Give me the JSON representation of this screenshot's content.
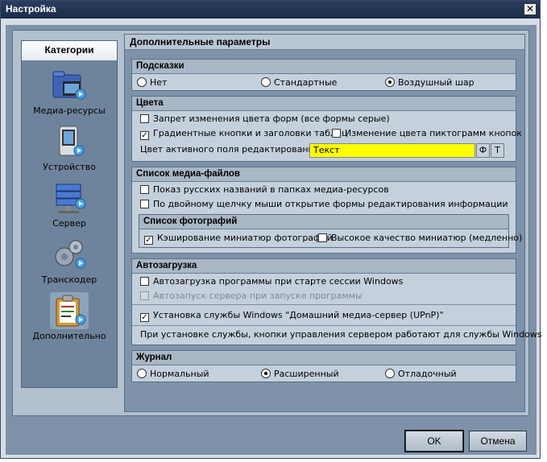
{
  "window": {
    "title": "Настройка"
  },
  "categories": {
    "header": "Категории",
    "items": [
      {
        "label": "Медиа-ресурсы"
      },
      {
        "label": "Устройство"
      },
      {
        "label": "Сервер"
      },
      {
        "label": "Транскодер"
      },
      {
        "label": "Дополнительно",
        "selected": true
      }
    ]
  },
  "main": {
    "title": "Дополнительные параметры",
    "hints": {
      "title": "Подсказки",
      "options": [
        "Нет",
        "Стандартные",
        "Воздушный шар"
      ],
      "selected": "Воздушный шар"
    },
    "colors": {
      "title": "Цвета",
      "forbid_change": "Запрет изменения цвета форм (все формы серые)",
      "gradient_buttons": "Градиентные кнопки и заголовки таблиц",
      "icon_color_change": "Изменение цвета пиктограмм кнопок",
      "active_field_label": "Цвет активного поля редактирования",
      "active_field_value": "Текст",
      "active_field_color": "#ffff00",
      "btn_f": "Ф",
      "btn_t": "Т"
    },
    "media_list": {
      "title": "Список медиа-файлов",
      "russian_names": "Показ русских названий в папках медиа-ресурсов",
      "double_click": "По двойному щелчку мыши открытие формы редактирования информации",
      "photos": {
        "title": "Список фотографий",
        "thumb_cache": "Кэширование миниатюр фотографий",
        "high_quality": "Высокое качество миниатюр (медленно)"
      }
    },
    "autoload": {
      "title": "Автозагрузка",
      "program_start": "Автозагрузка программы при старте сессии Windows",
      "server_start": "Автозапуск сервера при запуске программы",
      "install_service": "Установка службы Windows \"Домашний медиа-сервер (UPnP)\"",
      "note": "При установке службы, кнопки управления сервером работают для службы Windows"
    },
    "journal": {
      "title": "Журнал",
      "options": [
        "Нормальный",
        "Расширенный",
        "Отладочный"
      ],
      "selected": "Расширенный"
    }
  },
  "buttons": {
    "ok": "OK",
    "cancel": "Отмена"
  }
}
